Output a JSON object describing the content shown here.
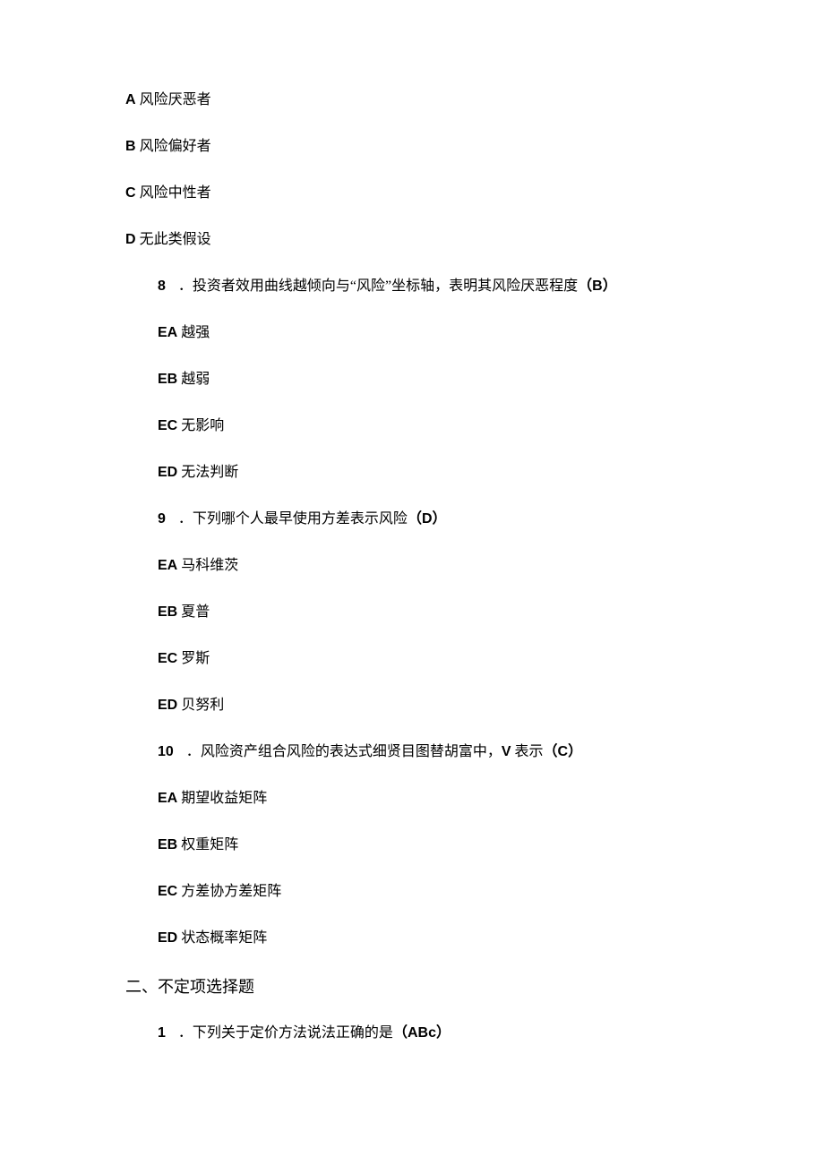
{
  "q7_options": {
    "a": {
      "letter": "A",
      "text": " 风险厌恶者"
    },
    "b": {
      "letter": "B",
      "text": " 风险偏好者"
    },
    "c": {
      "letter": "C",
      "text": " 风险中性者"
    },
    "d": {
      "letter": "D",
      "text": " 无此类假设"
    }
  },
  "q8": {
    "num": "8",
    "dot": "．",
    "stem": "投资者效用曲线越倾向与“风险”坐标轴，表明其风险厌恶程度",
    "ans_open": "（",
    "ans": "B",
    "ans_close": "）",
    "a": {
      "prefix": "EA",
      "text": " 越强"
    },
    "b": {
      "prefix": "EB",
      "text": " 越弱"
    },
    "c": {
      "prefix": "EC",
      "text": " 无影响"
    },
    "d": {
      "prefix": "ED",
      "text": " 无法判断"
    }
  },
  "q9": {
    "num": "9",
    "dot": "．",
    "stem": "下列哪个人最早使用方差表示风险",
    "ans_open": "（",
    "ans": "D",
    "ans_close": "）",
    "a": {
      "prefix": "EA",
      "text": " 马科维茨"
    },
    "b": {
      "prefix": "EB",
      "text": " 夏普"
    },
    "c": {
      "prefix": "EC",
      "text": " 罗斯"
    },
    "d": {
      "prefix": "ED",
      "text": " 贝努利"
    }
  },
  "q10": {
    "num": "10",
    "dot": "．",
    "stem": "风险资产组合风险的表达式细贤目图替胡富中，",
    "var": "V",
    "stem2": " 表示",
    "ans_open": "（",
    "ans": "C",
    "ans_close": "）",
    "a": {
      "prefix": "EA",
      "text": " 期望收益矩阵"
    },
    "b": {
      "prefix": "EB",
      "text": " 权重矩阵"
    },
    "c": {
      "prefix": "EC",
      "text": " 方差协方差矩阵"
    },
    "d": {
      "prefix": "ED",
      "text": " 状态概率矩阵"
    }
  },
  "section2": {
    "heading": "二、不定项选择题"
  },
  "s2q1": {
    "num": "1",
    "dot": "．",
    "stem": "下列关于定价方法说法正确的是",
    "ans_open": "（",
    "ans": "ABc",
    "ans_close": "）"
  }
}
